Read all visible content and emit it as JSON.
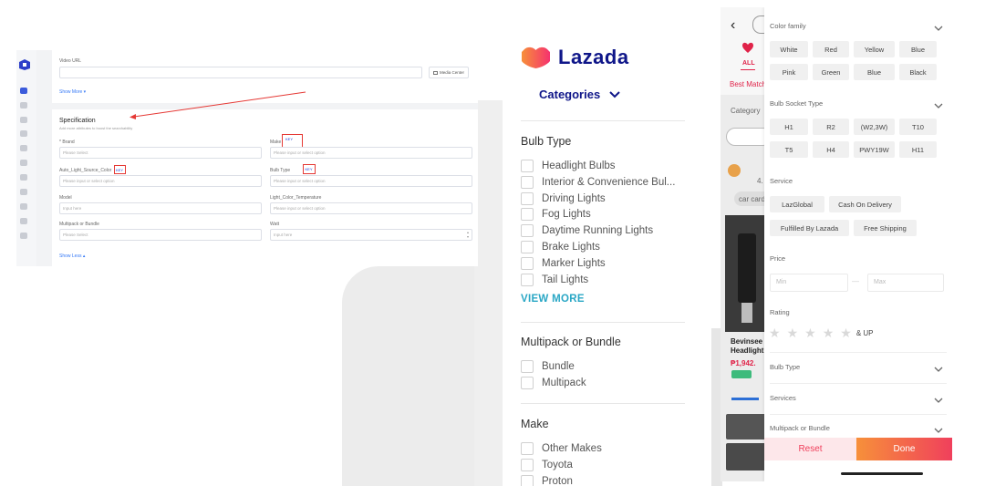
{
  "admin": {
    "video_url_label": "Video URL",
    "media_center": "Media Center",
    "show_more": "Show More",
    "spec_title": "Specification",
    "spec_hint": "Add more attributes to boost the searchability",
    "brand_label": "* Brand",
    "brand_placeholder": "Please Select",
    "make_label": "Make",
    "make_tag": "KEY",
    "make_placeholder": "Please input or select option",
    "auto_light_label": "Auto_Light_Source_Color",
    "auto_light_tag": "KEY",
    "auto_light_placeholder": "Please input or select option",
    "bulb_type_label": "Bulb Type",
    "bulb_type_tag": "KEY",
    "bulb_type_placeholder": "Please input or select option",
    "model_label": "Model",
    "model_placeholder": "Input here",
    "light_temp_label": "Light_Color_Temperature",
    "light_temp_placeholder": "Please input or select option",
    "multipack_label": "Multipack or Bundle",
    "multipack_placeholder": "Please Select",
    "watt_label": "Watt",
    "watt_placeholder": "Input here",
    "show_less": "Show Less",
    "colors": {
      "key_border": "#e53935",
      "arrow": "#e53935",
      "link": "#3478f6"
    }
  },
  "lazada": {
    "brand_name": "Lazada",
    "categories_label": "Categories",
    "bulb_type_title": "Bulb Type",
    "bulb_types": [
      "Headlight Bulbs",
      "Interior & Convenience Bul...",
      "Driving Lights",
      "Fog Lights",
      "Daytime Running Lights",
      "Brake Lights",
      "Marker Lights",
      "Tail Lights"
    ],
    "view_more": "VIEW MORE",
    "multipack_title": "Multipack or Bundle",
    "multipack_options": [
      "Bundle",
      "Multipack"
    ],
    "make_title": "Make",
    "make_options": [
      "Other Makes",
      "Toyota",
      "Proton"
    ],
    "colors": {
      "brand": "#0f1689",
      "view_more": "#2aa7c5",
      "logo_pink": "#f5326e",
      "logo_orange": "#f7903a"
    }
  },
  "phone": {
    "bg": {
      "all_tab": "ALL",
      "best_match": "Best Match",
      "category": "Category",
      "tag_cut": "car cards",
      "product_title_1": "Bevinsee",
      "product_title_2": "Headlight",
      "price": "₱1,942.",
      "rating_cut": "4."
    },
    "color_family_title": "Color family",
    "color_chips": [
      "White",
      "Red",
      "Yellow",
      "Blue",
      "Pink",
      "Green",
      "Blue",
      "Black"
    ],
    "bulb_socket_title": "Bulb Socket Type",
    "socket_chips": [
      "H1",
      "R2",
      "(W2,3W)",
      "T10",
      "T5",
      "H4",
      "PWY19W",
      "H11"
    ],
    "service_title": "Service",
    "service_chips": [
      "LazGlobal",
      "Cash On Delivery",
      "Fulfilled By Lazada",
      "Free Shipping"
    ],
    "price_title": "Price",
    "price_min": "Min",
    "price_max": "Max",
    "price_sep": "—",
    "rating_title": "Rating",
    "rating_suffix": "& UP",
    "rating_stars": 5,
    "collapsed_sections": [
      "Bulb Type",
      "Services",
      "Multipack or Bundle"
    ],
    "reset": "Reset",
    "done": "Done",
    "colors": {
      "reset_bg": "#fde7ea",
      "reset_text": "#f0405c",
      "done_start": "#f7903a",
      "done_end": "#f0405c",
      "accent": "#e02349"
    }
  }
}
